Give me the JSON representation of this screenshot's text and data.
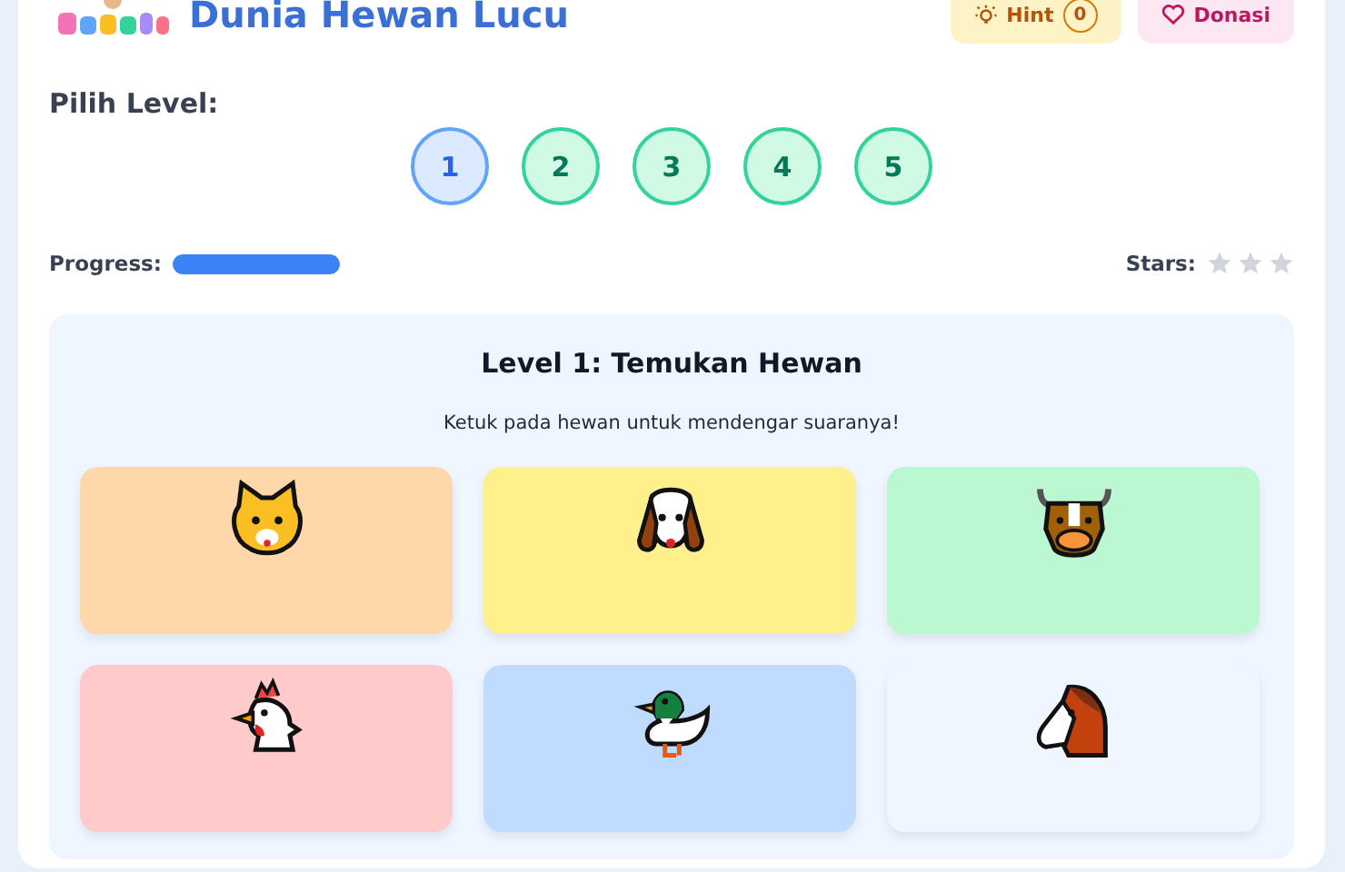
{
  "header": {
    "title": "Dunia Hewan Lucu",
    "hint": {
      "label": "Hint",
      "count": "0"
    },
    "donate": {
      "label": "Donasi"
    }
  },
  "level_picker": {
    "label": "Pilih Level:",
    "levels": [
      {
        "label": "1",
        "selected": true
      },
      {
        "label": "2",
        "selected": false
      },
      {
        "label": "3",
        "selected": false
      },
      {
        "label": "4",
        "selected": false
      },
      {
        "label": "5",
        "selected": false
      }
    ]
  },
  "progress": {
    "label": "Progress:",
    "level": 1
  },
  "stars": {
    "label": "Stars:",
    "stars": 0
  },
  "game": {
    "title": "Level 1: Temukan Hewan",
    "instruction": "Ketuk pada hewan untuk mendengar suaranya!",
    "animals": [
      {
        "kind": "cat",
        "color": "#fed7aa"
      },
      {
        "kind": "dog",
        "color": "#fef08a"
      },
      {
        "kind": "cow",
        "color": "#bbf7d0"
      },
      {
        "kind": "chicken",
        "color": "#fecaca"
      },
      {
        "kind": "duck",
        "color": "#bfdbfe"
      },
      {
        "kind": "horse",
        "color": "#eff6ff"
      }
    ]
  }
}
